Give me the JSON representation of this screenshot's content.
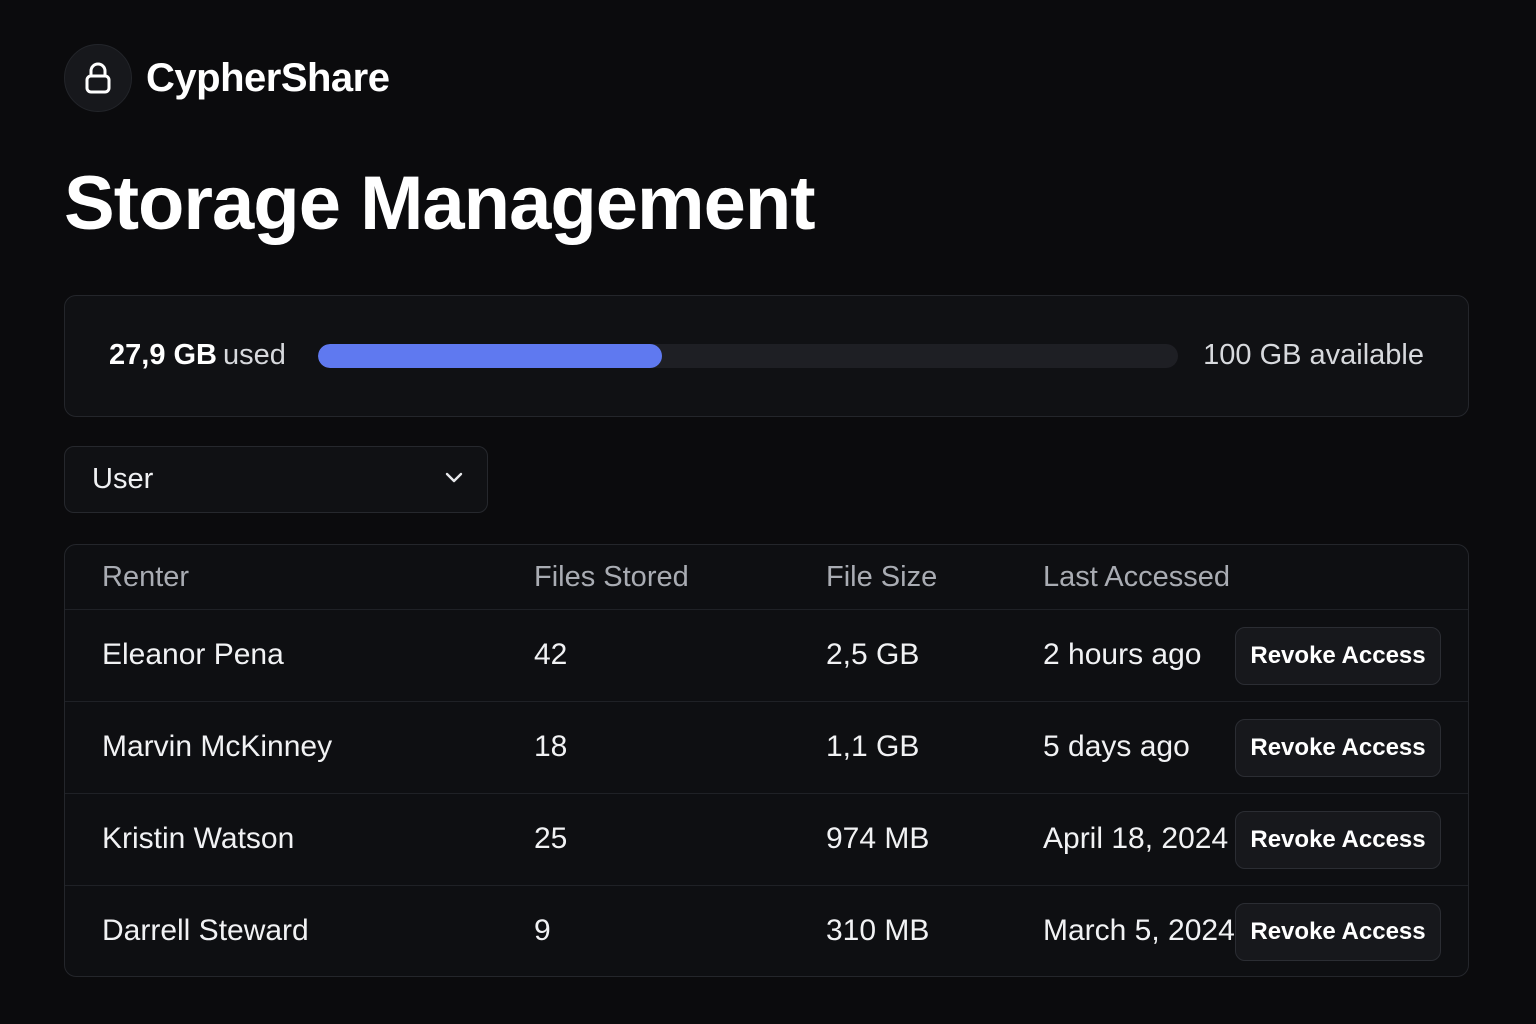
{
  "brand": {
    "name": "CypherShare",
    "icon": "lock-icon"
  },
  "page": {
    "title": "Storage Management"
  },
  "usage": {
    "used_amount": "27,9 GB",
    "used_label": "used",
    "total_label": "100 GB available",
    "fraction_used": 0.279,
    "bar_color": "#5f79f0"
  },
  "filter": {
    "selected": "User",
    "icon": "chevron-down-icon"
  },
  "table": {
    "columns": [
      "Renter",
      "Files Stored",
      "File Size",
      "Last Accessed"
    ],
    "rows": [
      {
        "renter": "Eleanor Pena",
        "files": "42",
        "size": "2,5 GB",
        "accessed": "2 hours ago",
        "action": "Revoke Access"
      },
      {
        "renter": "Marvin McKinney",
        "files": "18",
        "size": "1,1 GB",
        "accessed": "5 days ago",
        "action": "Revoke Access"
      },
      {
        "renter": "Kristin Watson",
        "files": "25",
        "size": "974 MB",
        "accessed": "April 18, 2024",
        "action": "Revoke Access"
      },
      {
        "renter": "Darrell Steward",
        "files": "9",
        "size": "310 MB",
        "accessed": "March 5, 2024",
        "action": "Revoke Access"
      }
    ]
  }
}
